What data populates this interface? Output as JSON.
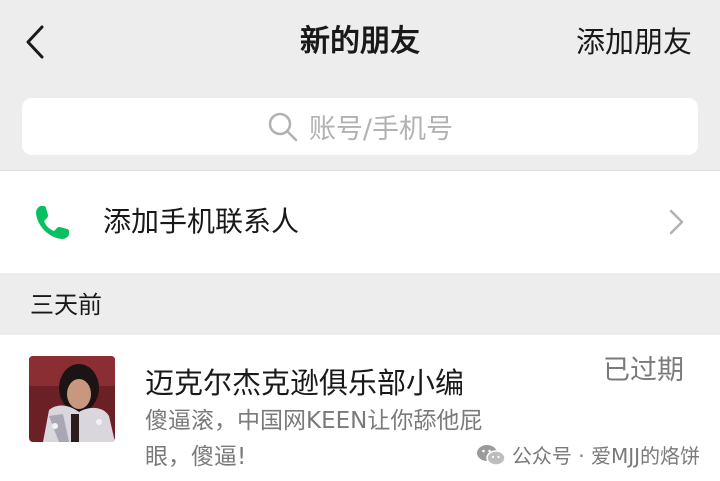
{
  "nav": {
    "title": "新的朋友",
    "add_friend_label": "添加朋友"
  },
  "search": {
    "placeholder": "账号/手机号"
  },
  "contacts_entry": {
    "label": "添加手机联系人"
  },
  "section": {
    "label": "三天前"
  },
  "request": {
    "name": "迈克尔杰克逊俱乐部小编",
    "message": "傻逼滚，中国网KEEN让你舔他屁眼，傻逼!",
    "status": "已过期"
  },
  "watermark": {
    "text": "公众号 · 爱MJJ的烙饼"
  },
  "colors": {
    "background": "#ededed",
    "phone_green": "#07c160",
    "muted_text": "#7a7a7a"
  }
}
